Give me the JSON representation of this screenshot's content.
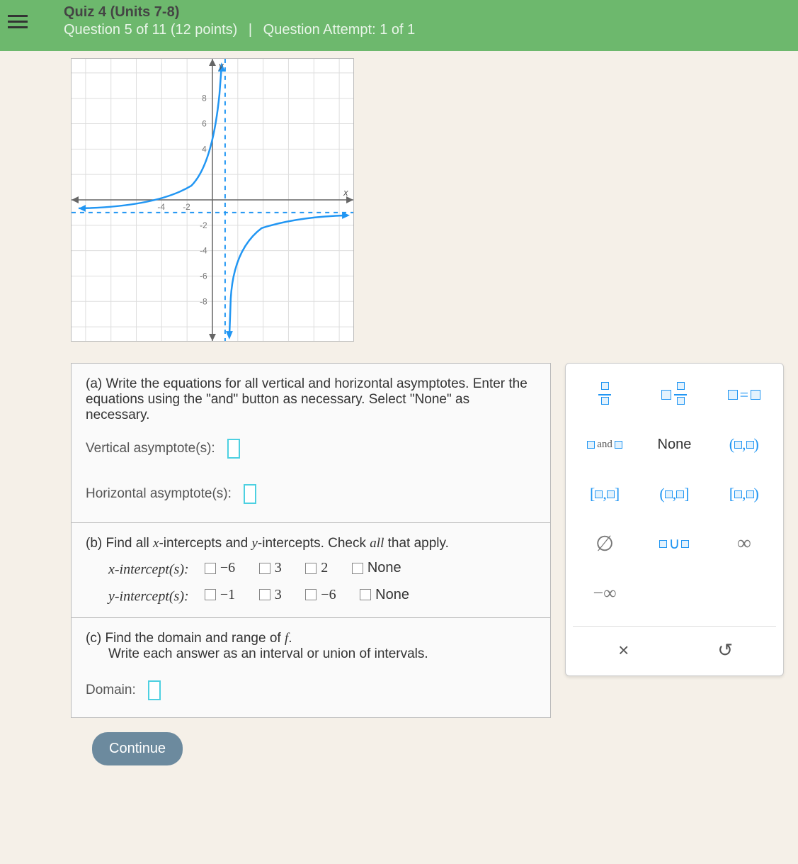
{
  "header": {
    "quiz_title": "Quiz 4 (Units 7-8)",
    "question_position": "Question 5 of 11 (12 points)",
    "attempt": "Question Attempt: 1 of 1"
  },
  "graph": {
    "y_axis_label": "y",
    "x_axis_label": "x",
    "y_ticks": [
      "8",
      "6",
      "4",
      "-2",
      "-4",
      "-6",
      "-8"
    ],
    "x_ticks": [
      "-4",
      "-2"
    ]
  },
  "parts": {
    "a": {
      "label": "(a)",
      "text": "Write the equations for all vertical and horizontal asymptotes. Enter the equations using the \"and\" button as necessary. Select \"None\" as necessary.",
      "vertical_label": "Vertical asymptote(s):",
      "horizontal_label": "Horizontal asymptote(s):"
    },
    "b": {
      "label": "(b)",
      "text_prefix": "Find all ",
      "text_x": "x",
      "text_mid": "-intercepts and ",
      "text_y": "y",
      "text_suffix": "-intercepts. Check ",
      "text_all": "all",
      "text_end": " that apply.",
      "x_label": "x-intercept(s):",
      "y_label": "y-intercept(s):",
      "x_options": [
        "−6",
        "3",
        "2",
        "None"
      ],
      "y_options": [
        "−1",
        "3",
        "−6",
        "None"
      ]
    },
    "c": {
      "label": "(c)",
      "text": "Find the domain and range of ",
      "f": "f",
      "text2": "Write each answer as an interval or union of intervals.",
      "domain_label": "Domain:"
    }
  },
  "toolbar": {
    "and_label": "and",
    "none_label": "None",
    "interval_oo": "(□,□)",
    "interval_cc": "[□,□]",
    "interval_oc": "(□,□]",
    "interval_co": "[□,□)",
    "empty_set": "∅",
    "union_label": "□∪□",
    "infinity": "∞",
    "neg_infinity": "−∞",
    "close": "×",
    "reset": "↺"
  },
  "continue_label": "Continue"
}
